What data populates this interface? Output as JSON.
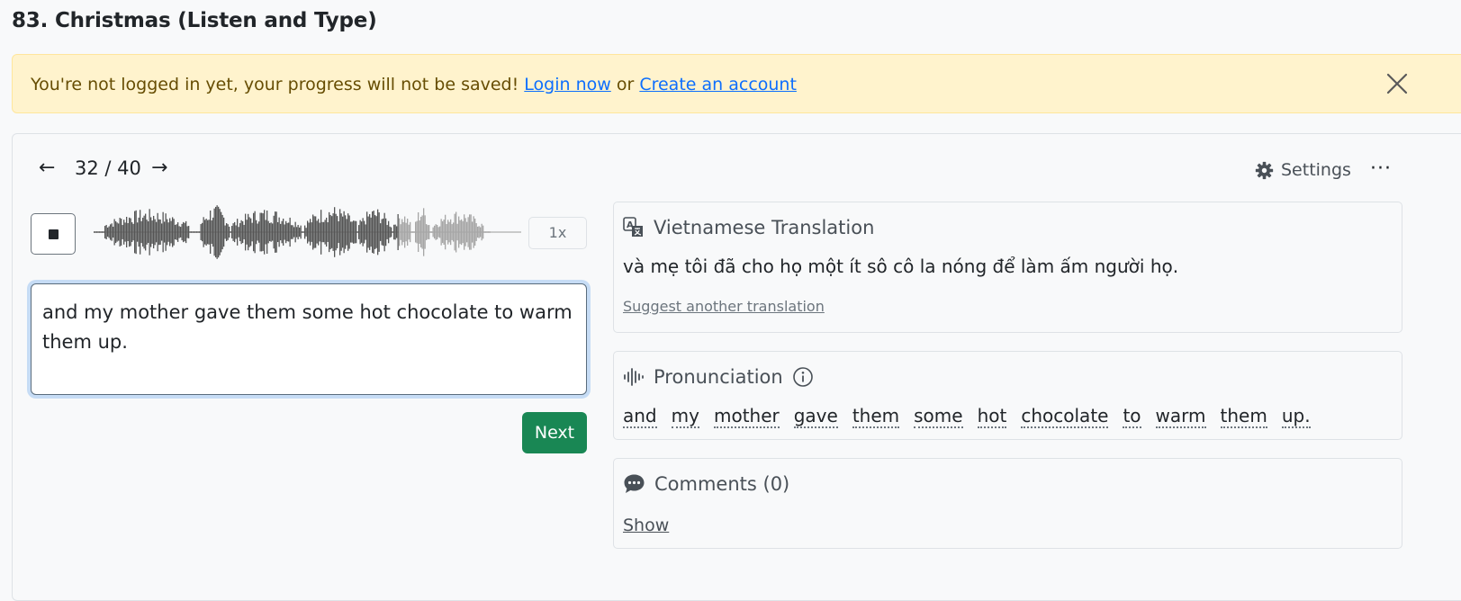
{
  "page": {
    "title": "83. Christmas (Listen and Type)"
  },
  "alert": {
    "message": "You're not logged in yet, your progress will not be saved!",
    "login_link": "Login now",
    "separator": "or",
    "create_link": "Create an account"
  },
  "nav": {
    "prev_arrow": "←",
    "counter": "32 / 40",
    "next_arrow": "→"
  },
  "toolbar": {
    "settings_label": "Settings",
    "more_label": "···"
  },
  "player": {
    "state": "playing",
    "playback_progress": 0.77,
    "speed": "1x"
  },
  "answer": {
    "value": "and my mother gave them some hot chocolate to warm them up."
  },
  "actions": {
    "next_label": "Next"
  },
  "translation": {
    "title": "Vietnamese Translation",
    "text": "và mẹ tôi đã cho họ một ít sô cô la nóng để làm ấm người họ.",
    "suggest_link": "Suggest another translation"
  },
  "pronunciation": {
    "title": "Pronunciation",
    "words": [
      "and",
      "my",
      "mother",
      "gave",
      "them",
      "some",
      "hot",
      "chocolate",
      "to",
      "warm",
      "them",
      "up."
    ]
  },
  "comments": {
    "title": "Comments (0)",
    "show_link": "Show"
  },
  "colors": {
    "alert_bg": "#fff3cd",
    "alert_text": "#664d03",
    "link": "#0d6efd",
    "next_button": "#198754",
    "wave_played": "#555555",
    "wave_unplayed": "#a6a6a6",
    "focus_ring": "#c6dcf5"
  }
}
